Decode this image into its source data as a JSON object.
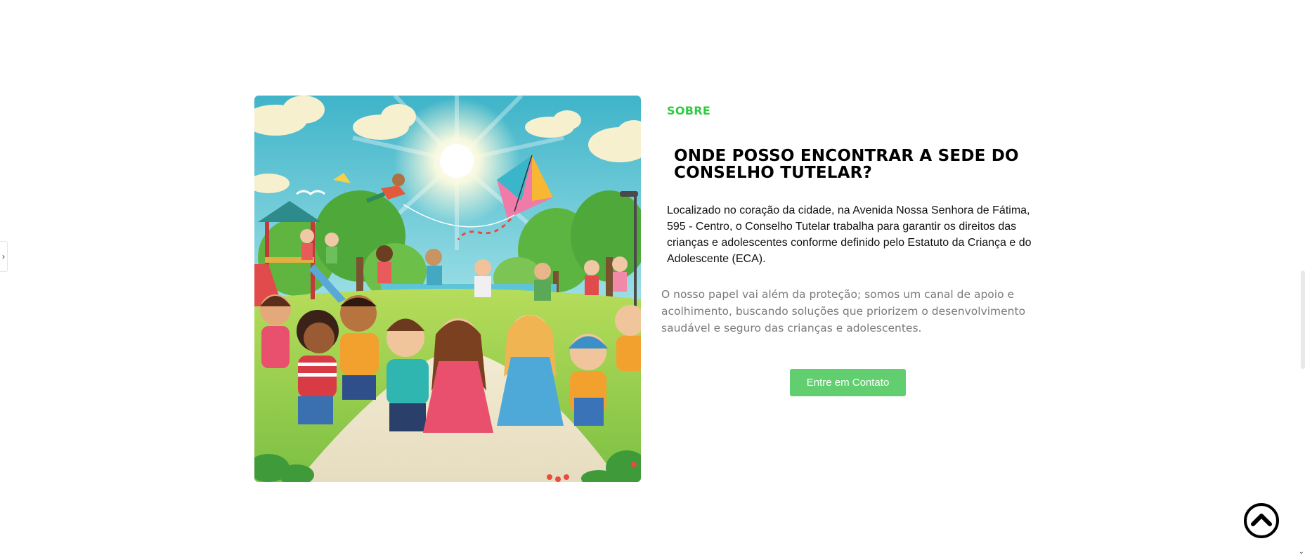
{
  "about": {
    "eyebrow": "SOBRE",
    "title": "ONDE POSSO ENCONTRAR A SEDE DO CONSELHO TUTELAR?",
    "lead": "Localizado no coração da cidade, na Avenida Nossa Senhora de Fátima, 595 - Centro, o Conselho Tutelar trabalha para garantir os direitos das crianças e adolescentes conforme definido pelo Estatuto da Criança e do Adolescente (ECA).",
    "secondary": "O nosso papel vai além da proteção; somos um canal de apoio e acolhimento, buscando soluções que priorizem o desenvolvimento saudável e seguro das crianças e adolescentes.",
    "cta_label": "Entre em Contato"
  },
  "image": {
    "description_icon": "children-playing-park-illustration"
  },
  "icons": {
    "side_handle": "chevron-right-icon",
    "back_to_top": "chevron-up-circle-icon",
    "scroll_down": "chevron-down-icon"
  },
  "colors": {
    "accent_green": "#2ecc40",
    "button_green": "#61ce70",
    "secondary_text": "#7a7a7a"
  }
}
